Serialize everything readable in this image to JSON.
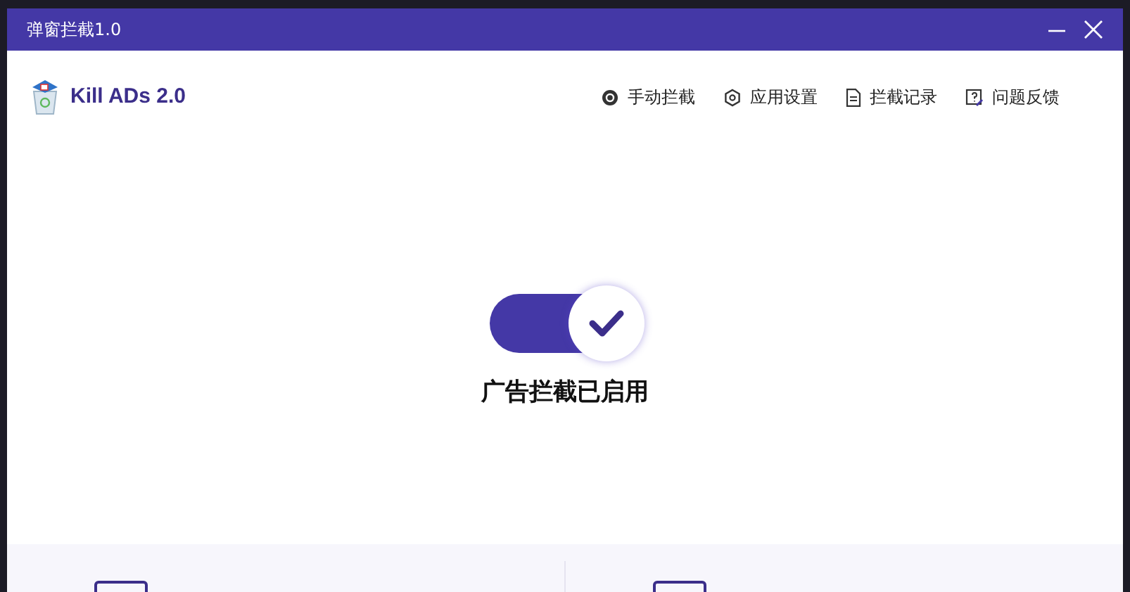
{
  "window": {
    "title": "弹窗拦截1.0"
  },
  "app": {
    "name": "Kill ADs 2.0"
  },
  "nav": [
    {
      "label": "手动拦截"
    },
    {
      "label": "应用设置"
    },
    {
      "label": "拦截记录"
    },
    {
      "label": "问题反馈"
    }
  ],
  "toggle": {
    "on": true,
    "label": "广告拦截已启用"
  }
}
